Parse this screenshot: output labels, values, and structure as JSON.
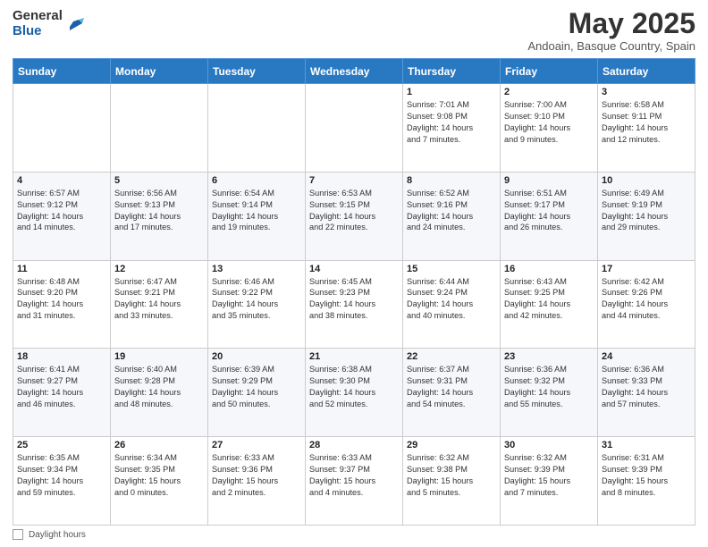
{
  "header": {
    "logo_general": "General",
    "logo_blue": "Blue",
    "month_title": "May 2025",
    "location": "Andoain, Basque Country, Spain"
  },
  "weekdays": [
    "Sunday",
    "Monday",
    "Tuesday",
    "Wednesday",
    "Thursday",
    "Friday",
    "Saturday"
  ],
  "weeks": [
    [
      {
        "day": "",
        "info": ""
      },
      {
        "day": "",
        "info": ""
      },
      {
        "day": "",
        "info": ""
      },
      {
        "day": "",
        "info": ""
      },
      {
        "day": "1",
        "info": "Sunrise: 7:01 AM\nSunset: 9:08 PM\nDaylight: 14 hours\nand 7 minutes."
      },
      {
        "day": "2",
        "info": "Sunrise: 7:00 AM\nSunset: 9:10 PM\nDaylight: 14 hours\nand 9 minutes."
      },
      {
        "day": "3",
        "info": "Sunrise: 6:58 AM\nSunset: 9:11 PM\nDaylight: 14 hours\nand 12 minutes."
      }
    ],
    [
      {
        "day": "4",
        "info": "Sunrise: 6:57 AM\nSunset: 9:12 PM\nDaylight: 14 hours\nand 14 minutes."
      },
      {
        "day": "5",
        "info": "Sunrise: 6:56 AM\nSunset: 9:13 PM\nDaylight: 14 hours\nand 17 minutes."
      },
      {
        "day": "6",
        "info": "Sunrise: 6:54 AM\nSunset: 9:14 PM\nDaylight: 14 hours\nand 19 minutes."
      },
      {
        "day": "7",
        "info": "Sunrise: 6:53 AM\nSunset: 9:15 PM\nDaylight: 14 hours\nand 22 minutes."
      },
      {
        "day": "8",
        "info": "Sunrise: 6:52 AM\nSunset: 9:16 PM\nDaylight: 14 hours\nand 24 minutes."
      },
      {
        "day": "9",
        "info": "Sunrise: 6:51 AM\nSunset: 9:17 PM\nDaylight: 14 hours\nand 26 minutes."
      },
      {
        "day": "10",
        "info": "Sunrise: 6:49 AM\nSunset: 9:19 PM\nDaylight: 14 hours\nand 29 minutes."
      }
    ],
    [
      {
        "day": "11",
        "info": "Sunrise: 6:48 AM\nSunset: 9:20 PM\nDaylight: 14 hours\nand 31 minutes."
      },
      {
        "day": "12",
        "info": "Sunrise: 6:47 AM\nSunset: 9:21 PM\nDaylight: 14 hours\nand 33 minutes."
      },
      {
        "day": "13",
        "info": "Sunrise: 6:46 AM\nSunset: 9:22 PM\nDaylight: 14 hours\nand 35 minutes."
      },
      {
        "day": "14",
        "info": "Sunrise: 6:45 AM\nSunset: 9:23 PM\nDaylight: 14 hours\nand 38 minutes."
      },
      {
        "day": "15",
        "info": "Sunrise: 6:44 AM\nSunset: 9:24 PM\nDaylight: 14 hours\nand 40 minutes."
      },
      {
        "day": "16",
        "info": "Sunrise: 6:43 AM\nSunset: 9:25 PM\nDaylight: 14 hours\nand 42 minutes."
      },
      {
        "day": "17",
        "info": "Sunrise: 6:42 AM\nSunset: 9:26 PM\nDaylight: 14 hours\nand 44 minutes."
      }
    ],
    [
      {
        "day": "18",
        "info": "Sunrise: 6:41 AM\nSunset: 9:27 PM\nDaylight: 14 hours\nand 46 minutes."
      },
      {
        "day": "19",
        "info": "Sunrise: 6:40 AM\nSunset: 9:28 PM\nDaylight: 14 hours\nand 48 minutes."
      },
      {
        "day": "20",
        "info": "Sunrise: 6:39 AM\nSunset: 9:29 PM\nDaylight: 14 hours\nand 50 minutes."
      },
      {
        "day": "21",
        "info": "Sunrise: 6:38 AM\nSunset: 9:30 PM\nDaylight: 14 hours\nand 52 minutes."
      },
      {
        "day": "22",
        "info": "Sunrise: 6:37 AM\nSunset: 9:31 PM\nDaylight: 14 hours\nand 54 minutes."
      },
      {
        "day": "23",
        "info": "Sunrise: 6:36 AM\nSunset: 9:32 PM\nDaylight: 14 hours\nand 55 minutes."
      },
      {
        "day": "24",
        "info": "Sunrise: 6:36 AM\nSunset: 9:33 PM\nDaylight: 14 hours\nand 57 minutes."
      }
    ],
    [
      {
        "day": "25",
        "info": "Sunrise: 6:35 AM\nSunset: 9:34 PM\nDaylight: 14 hours\nand 59 minutes."
      },
      {
        "day": "26",
        "info": "Sunrise: 6:34 AM\nSunset: 9:35 PM\nDaylight: 15 hours\nand 0 minutes."
      },
      {
        "day": "27",
        "info": "Sunrise: 6:33 AM\nSunset: 9:36 PM\nDaylight: 15 hours\nand 2 minutes."
      },
      {
        "day": "28",
        "info": "Sunrise: 6:33 AM\nSunset: 9:37 PM\nDaylight: 15 hours\nand 4 minutes."
      },
      {
        "day": "29",
        "info": "Sunrise: 6:32 AM\nSunset: 9:38 PM\nDaylight: 15 hours\nand 5 minutes."
      },
      {
        "day": "30",
        "info": "Sunrise: 6:32 AM\nSunset: 9:39 PM\nDaylight: 15 hours\nand 7 minutes."
      },
      {
        "day": "31",
        "info": "Sunrise: 6:31 AM\nSunset: 9:39 PM\nDaylight: 15 hours\nand 8 minutes."
      }
    ]
  ],
  "footer": {
    "daylight_label": "Daylight hours"
  }
}
